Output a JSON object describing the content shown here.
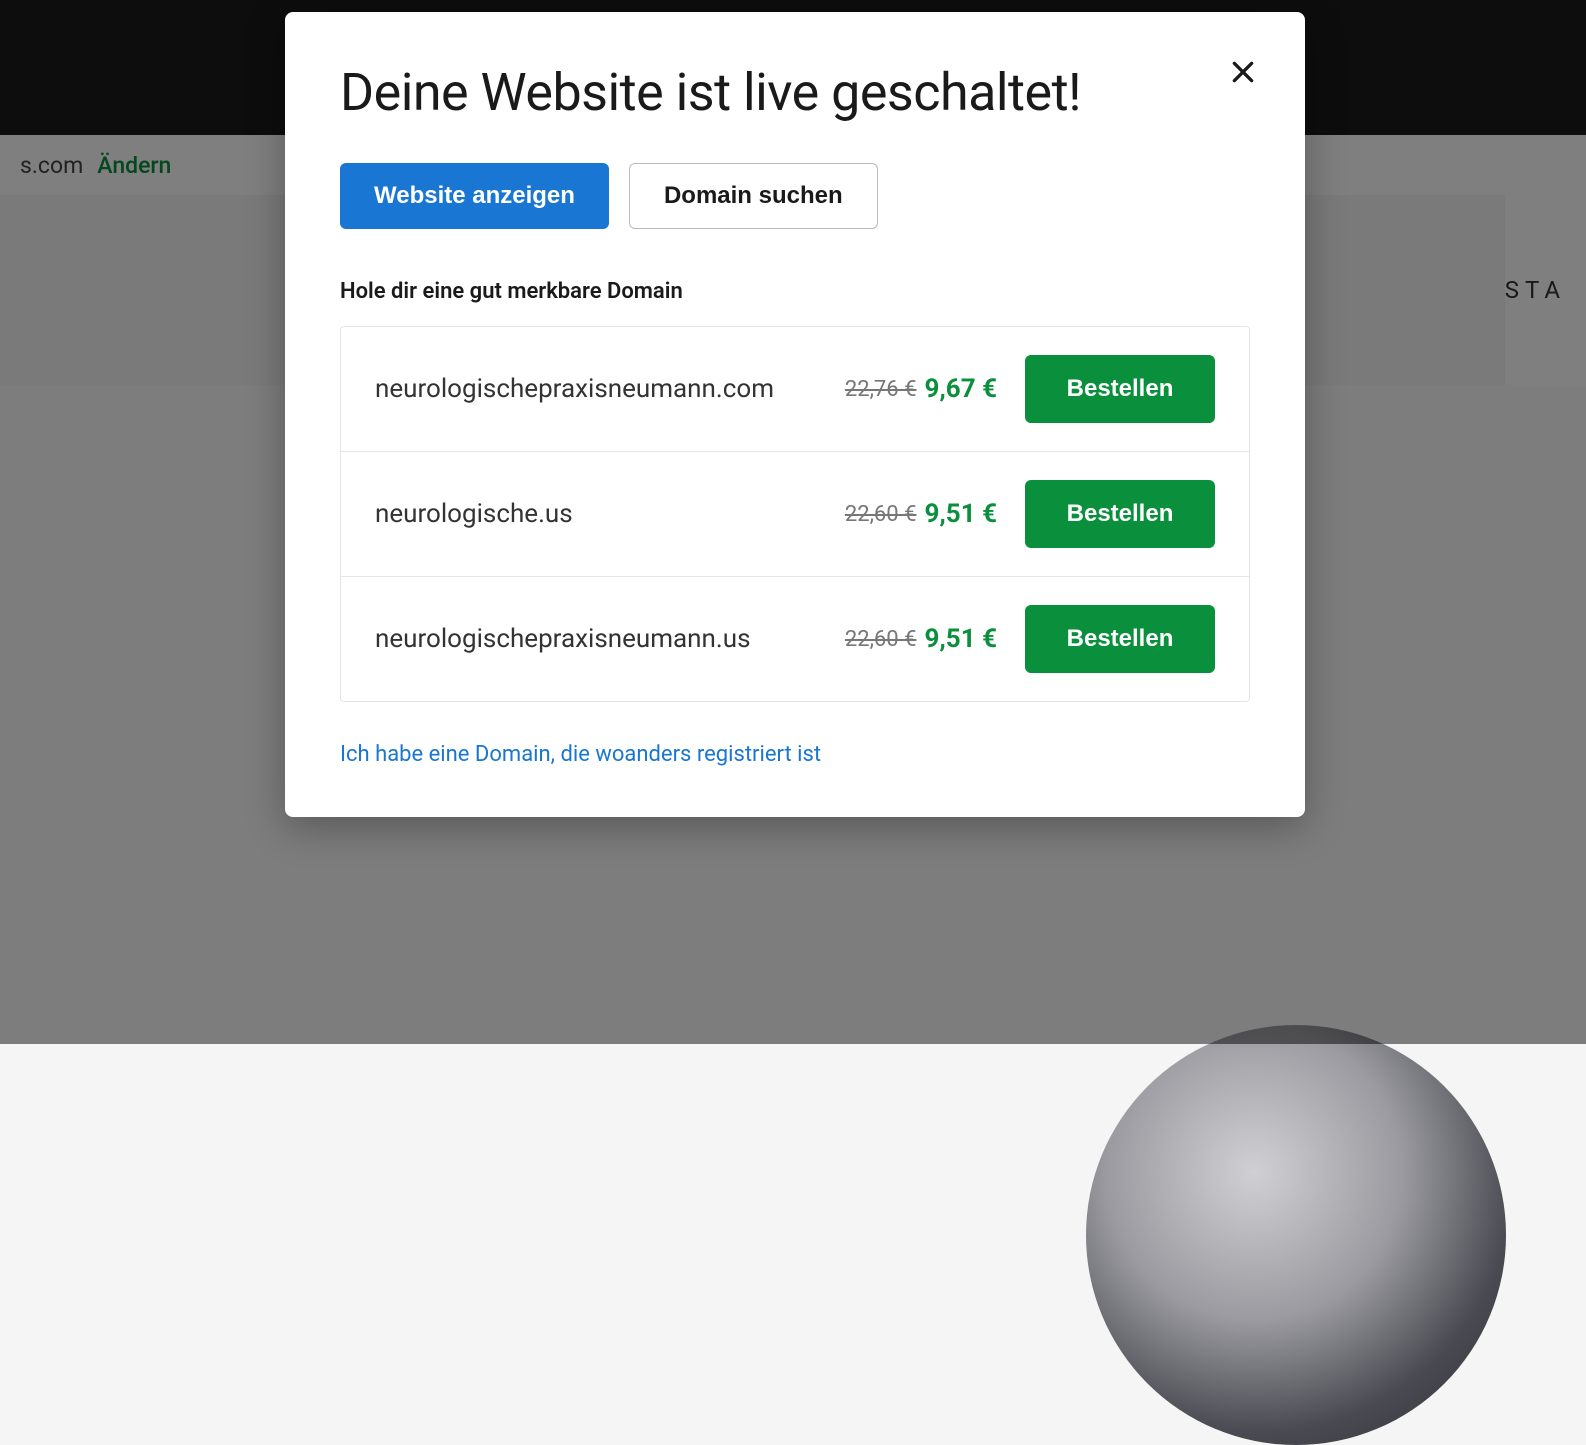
{
  "background": {
    "domain_suffix": "s.com",
    "change_label": "Ändern",
    "nav_partial": "STA"
  },
  "modal": {
    "title": "Deine Website ist live geschaltet!",
    "view_site_label": "Website anzeigen",
    "search_domain_label": "Domain suchen",
    "section_label": "Hole dir eine gut merkbare Domain",
    "domains": [
      {
        "name": "neurologischepraxisneumann.com",
        "old_price": "22,76 €",
        "new_price": "9,67 €",
        "order_label": "Bestellen"
      },
      {
        "name": "neurologische.us",
        "old_price": "22,60 €",
        "new_price": "9,51 €",
        "order_label": "Bestellen"
      },
      {
        "name": "neurologischepraxisneumann.us",
        "old_price": "22,60 €",
        "new_price": "9,51 €",
        "order_label": "Bestellen"
      }
    ],
    "existing_domain_link": "Ich habe eine Domain, die woanders registriert ist"
  }
}
